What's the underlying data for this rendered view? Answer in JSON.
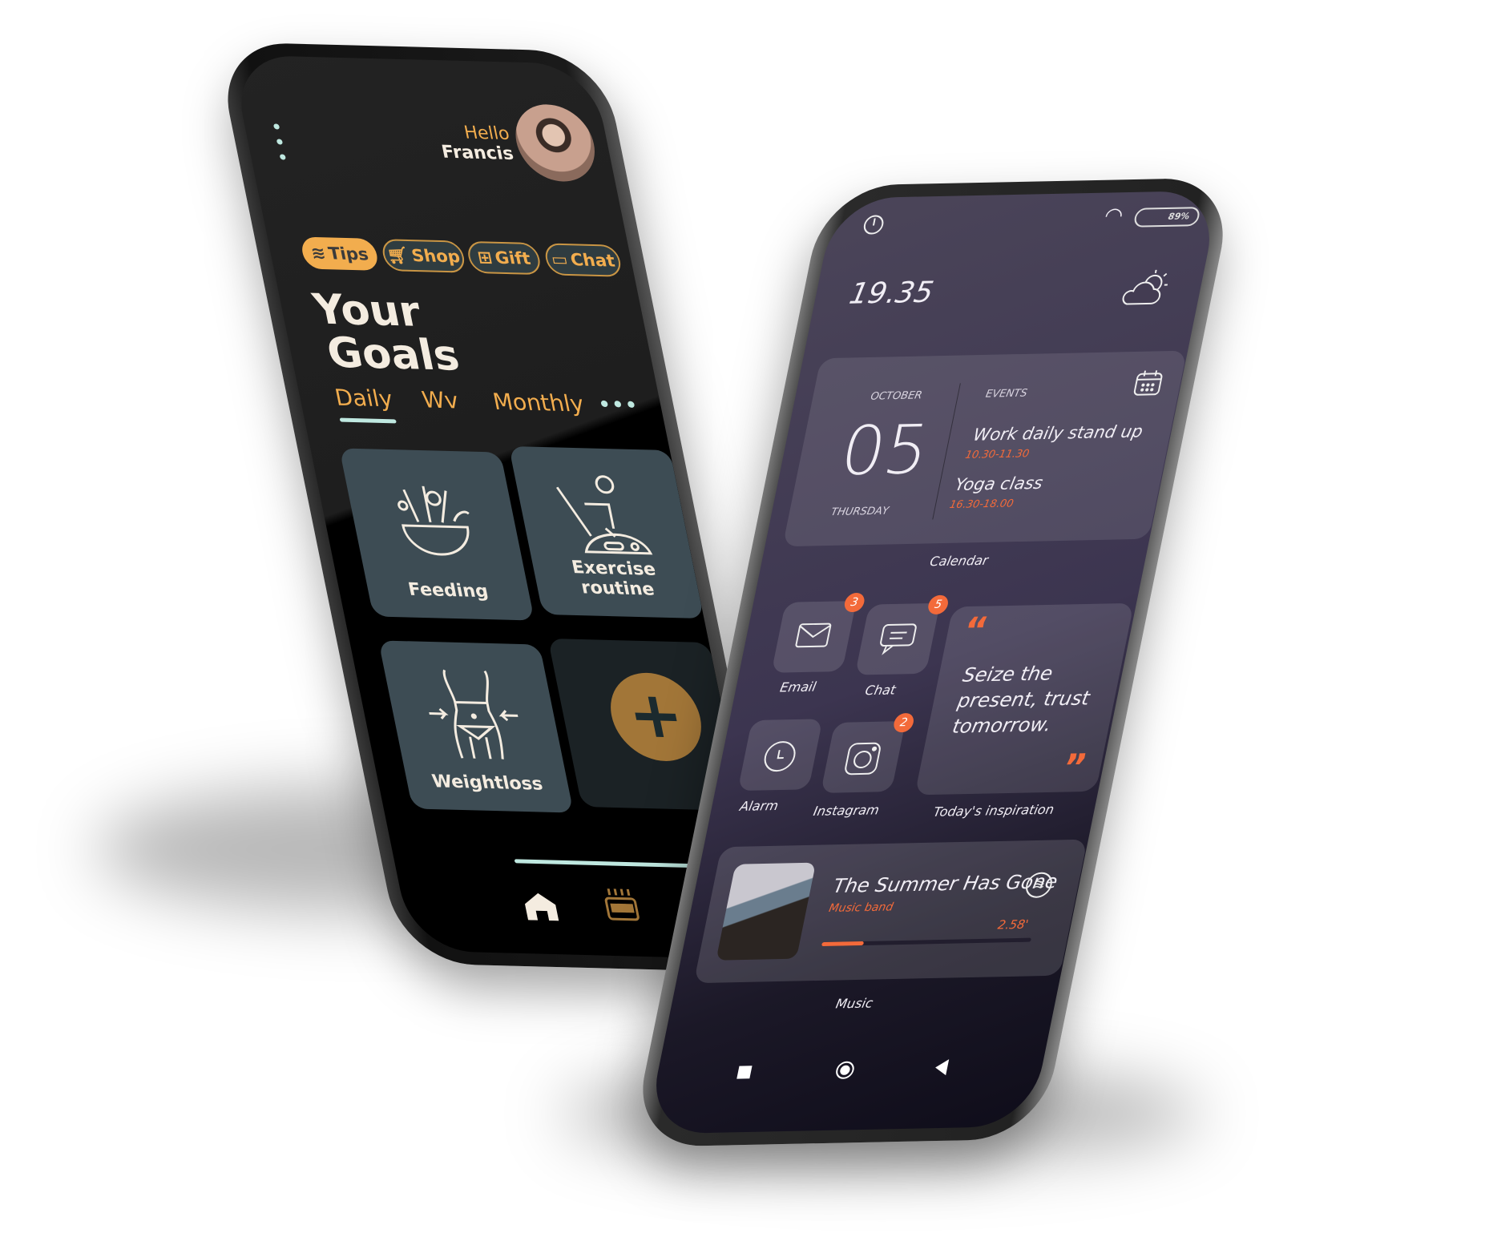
{
  "left_phone": {
    "greeting": "Hello",
    "user_name": "Francis",
    "chips": [
      {
        "label": "Tips",
        "icon": "waves-icon",
        "active": true
      },
      {
        "label": "Shop",
        "icon": "cart-icon",
        "active": false
      },
      {
        "label": "Gift",
        "icon": "gift-icon",
        "active": false
      },
      {
        "label": "Chat",
        "icon": "chat-bubble-icon",
        "active": false
      }
    ],
    "title_line1": "Your",
    "title_line2": "Goals",
    "tabs": [
      {
        "label": "Daily",
        "active": true
      },
      {
        "label": "Wv",
        "active": false
      },
      {
        "label": "Monthly",
        "active": false
      }
    ],
    "tiles": [
      {
        "label": "Feeding",
        "icon": "food-bowl-icon"
      },
      {
        "label": "Exercise routine",
        "icon": "exercise-bike-icon"
      },
      {
        "label": "Weightloss",
        "icon": "waist-icon"
      }
    ],
    "add_icon": "plus-icon",
    "colors": {
      "accent": "#f2ad4e",
      "tile": "#3d4c54",
      "indicator": "#bfe8e0"
    }
  },
  "right_phone": {
    "battery": "89%",
    "time": "19.35",
    "calendar": {
      "month": "OCTOBER",
      "day": "05",
      "weekday": "THURSDAY",
      "events_label": "EVENTS",
      "events": [
        {
          "title": "Work daily stand up",
          "time": "10.30-11.30"
        },
        {
          "title": "Yoga class",
          "time": "16.30-18.00"
        }
      ],
      "caption": "Calendar"
    },
    "apps": [
      {
        "label": "Email",
        "icon": "envelope-icon",
        "badge": "3"
      },
      {
        "label": "Chat",
        "icon": "chat-icon",
        "badge": "5"
      },
      {
        "label": "Alarm",
        "icon": "clock-icon",
        "badge": ""
      },
      {
        "label": "Instagram",
        "icon": "instagram-icon",
        "badge": "2"
      }
    ],
    "quote": {
      "open": "“",
      "text": "Seize the present, trust tomorrow.",
      "close": "”",
      "caption": "Today's inspiration"
    },
    "music": {
      "title": "The Summer Has Gone",
      "artist": "Music band",
      "duration": "2.58'",
      "progress": 0.2,
      "caption": "Music"
    },
    "colors": {
      "accent": "#f36a3a"
    }
  }
}
